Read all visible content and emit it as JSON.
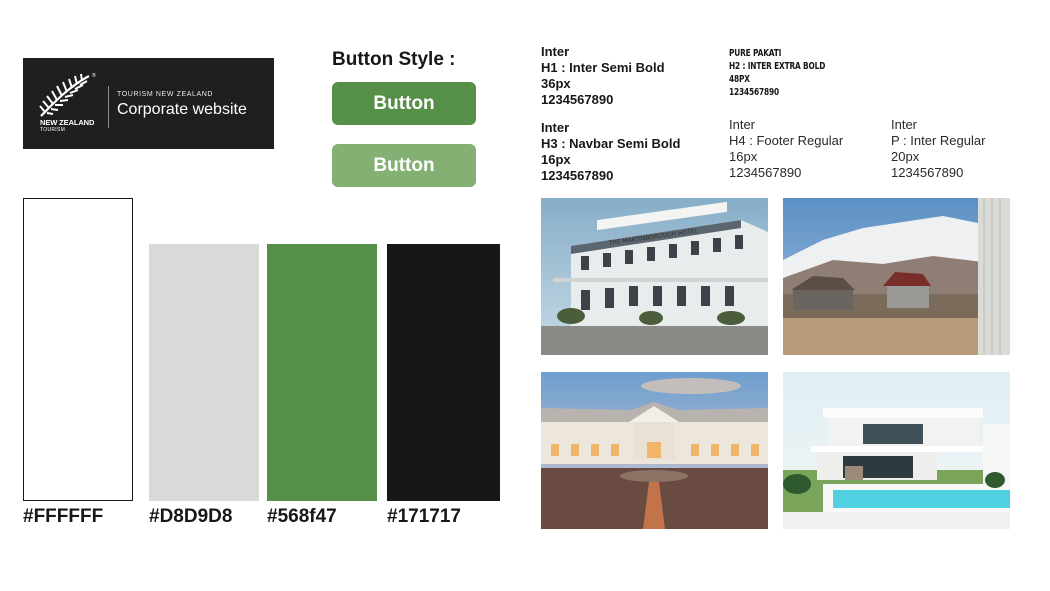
{
  "logo": {
    "brand_name": "NEW ZEALAND",
    "brand_sub": "TOURISM",
    "small_text": "TOURISM NEW ZEALAND",
    "large_text": "Corporate website",
    "icon": "silver-fern-icon",
    "registered_mark": "®"
  },
  "buttons": {
    "title": "Button Style :",
    "primary_label": "Button",
    "secondary_label": "Button",
    "primary_color": "#568f47",
    "secondary_color": "#85b074"
  },
  "typography": {
    "h1": {
      "font": "Inter",
      "name": "H1 : Inter Semi Bold",
      "size": "36px",
      "sample": "1234567890"
    },
    "h2": {
      "font": "PURE PAKATI",
      "name": "H2 : INTER EXTRA BOLD",
      "size": "48PX",
      "sample": "1234567890"
    },
    "h3": {
      "font": "Inter",
      "name": "H3 : Navbar Semi Bold",
      "size": "16px",
      "sample": "1234567890"
    },
    "h4": {
      "font": "Inter",
      "name": "H4 : Footer Regular",
      "size": "16px",
      "sample": "1234567890"
    },
    "p": {
      "font": "Inter",
      "name": "P : Inter Regular",
      "size": "20px",
      "sample": "1234567890"
    }
  },
  "palette": [
    {
      "hex": "#FFFFFF",
      "label": "#FFFFFF"
    },
    {
      "hex": "#D8D9D8",
      "label": "#D8D9D8"
    },
    {
      "hex": "#568f47",
      "label": "#568f47"
    },
    {
      "hex": "#171717",
      "label": "#171717"
    }
  ],
  "photos": [
    {
      "icon": "historic-hotel-photo",
      "sign": "THE MARTINBOROUGH HOTEL"
    },
    {
      "icon": "mountain-cottage-photo"
    },
    {
      "icon": "colonial-lodge-photo"
    },
    {
      "icon": "modern-villa-pool-photo"
    }
  ]
}
